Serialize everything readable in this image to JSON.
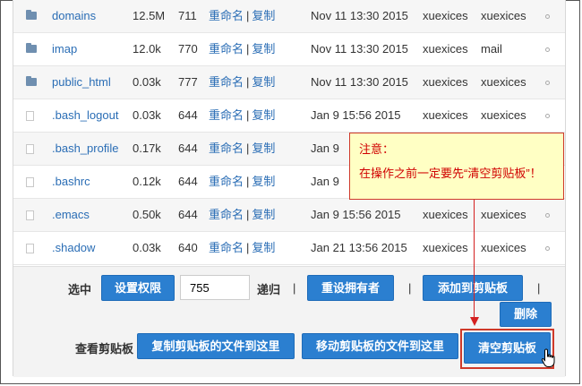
{
  "files": [
    {
      "type": "folder",
      "name": "domains",
      "size": "12.5M",
      "perm": "711",
      "rename": "重命名",
      "copy": "复制",
      "date": "Nov 11 13:30 2015",
      "owner": "xuexices",
      "group": "xuexices"
    },
    {
      "type": "folder",
      "name": "imap",
      "size": "12.0k",
      "perm": "770",
      "rename": "重命名",
      "copy": "复制",
      "date": "Nov 11 13:30 2015",
      "owner": "xuexices",
      "group": "mail"
    },
    {
      "type": "folder",
      "name": "public_html",
      "size": "0.03k",
      "perm": "777",
      "rename": "重命名",
      "copy": "复制",
      "date": "Nov 11 13:30 2015",
      "owner": "xuexices",
      "group": "xuexices"
    },
    {
      "type": "file",
      "name": ".bash_logout",
      "size": "0.03k",
      "perm": "644",
      "rename": "重命名",
      "copy": "复制",
      "date": "Jan 9 15:56 2015",
      "owner": "xuexices",
      "group": "xuexices"
    },
    {
      "type": "file",
      "name": ".bash_profile",
      "size": "0.17k",
      "perm": "644",
      "rename": "重命名",
      "copy": "复制",
      "date": "Jan 9",
      "owner": "",
      "group": ""
    },
    {
      "type": "file",
      "name": ".bashrc",
      "size": "0.12k",
      "perm": "644",
      "rename": "重命名",
      "copy": "复制",
      "date": "Jan 9",
      "owner": "",
      "group": ""
    },
    {
      "type": "file",
      "name": ".emacs",
      "size": "0.50k",
      "perm": "644",
      "rename": "重命名",
      "copy": "复制",
      "date": "Jan 9 15:56 2015",
      "owner": "xuexices",
      "group": "xuexices"
    },
    {
      "type": "file",
      "name": ".shadow",
      "size": "0.03k",
      "perm": "640",
      "rename": "重命名",
      "copy": "复制",
      "date": "Jan 21 13:56 2015",
      "owner": "xuexices",
      "group": "xuexices"
    }
  ],
  "selection": {
    "label": "选中",
    "set_permission": "设置权限",
    "permission_value": "755",
    "recursive": "递归",
    "reset_owner": "重设拥有者",
    "add_clipboard": "添加到剪贴板",
    "delete": "删除",
    "pipe": "|"
  },
  "clipboard": {
    "label": "查看剪贴板",
    "copy_here": "复制剪贴板的文件到这里",
    "move_here": "移动剪贴板的文件到这里",
    "clear": "清空剪贴板"
  },
  "callout": {
    "title": "注意：",
    "text": "在操作之前一定要先“清空剪贴板”！"
  },
  "colors": {
    "link": "#2a6db5",
    "button": "#2b7fd0",
    "callout_bg": "#ffffc4",
    "callout_text": "#d00000"
  }
}
